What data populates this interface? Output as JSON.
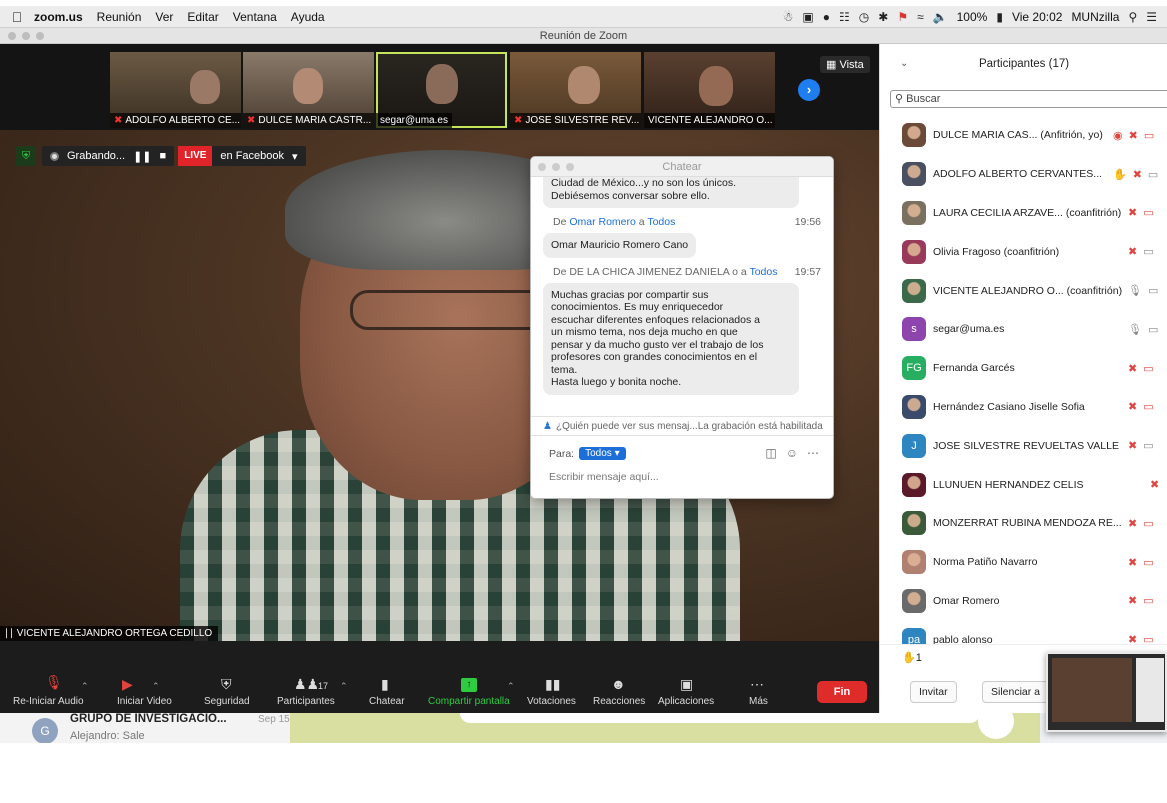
{
  "menubar": {
    "app": "zoom.us",
    "items": [
      "Reunión",
      "Ver",
      "Editar",
      "Ventana",
      "Ayuda"
    ],
    "battery": "100%",
    "clock": "Vie 20:02",
    "user": "MUNzilla"
  },
  "window": {
    "title": "Reunión de Zoom"
  },
  "thumbs": [
    {
      "name": "ADOLFO ALBERTO CE...",
      "muted": true
    },
    {
      "name": "DULCE MARIA CASTR...",
      "muted": true
    },
    {
      "name": "segar@uma.es",
      "muted": false
    },
    {
      "name": "JOSE SILVESTRE REV...",
      "muted": true
    },
    {
      "name": "VICENTE ALEJANDRO O...",
      "muted": false
    }
  ],
  "vista_label": "Vista",
  "recording": {
    "label": "Grabando...",
    "live": "LIVE",
    "live_target": "en Facebook"
  },
  "speaker_name": "VICENTE ALEJANDRO ORTEGA CEDILLO",
  "chat": {
    "title": "Chatear",
    "msg0_line1": "Ciudad de México...y no son los únicos.",
    "msg0_line2": "Debiésemos conversar sobre ello.",
    "msg1_from": "Omar Romero",
    "msg1_to": "Todos",
    "msg1_time": "19:56",
    "msg1_text": "Omar Mauricio Romero Cano",
    "msg2_from": "DE LA CHICA JIMENEZ DANIELA o",
    "msg2_to": "Todos",
    "msg2_time": "19:57",
    "msg2_text": [
      "Muchas gracias por compartir sus",
      "conocimientos. Es muy enriquecedor",
      "escuchar diferentes enfoques relacionados a",
      "un mismo tema, nos deja mucho en que",
      "pensar y da mucho gusto ver el trabajo de los",
      "profesores con grandes conocimientos en el",
      "tema.",
      "Hasta luego y bonita noche."
    ],
    "note": "¿Quién puede ver sus mensaj...La grabación está habilitada",
    "to_label": "Para:",
    "to_value": "Todos",
    "input_placeholder": "Escribir mensaje aquí..."
  },
  "toolbar": {
    "audio": "Re-Iniciar Audio",
    "video": "Iniciar Video",
    "security": "Seguridad",
    "participants": "Participantes",
    "participants_count": "17",
    "chat": "Chatear",
    "share": "Compartir pantalla",
    "polls": "Votaciones",
    "reactions": "Reacciones",
    "apps": "Aplicaciones",
    "more": "Más",
    "end": "Fin"
  },
  "panel": {
    "title": "Participantes (17)",
    "search_placeholder": "Buscar",
    "participants": [
      {
        "name": "DULCE MARIA CAS...",
        "role": "(Anfitrión, yo)",
        "avatar": "photo",
        "color": "#6b4a3a",
        "icons": [
          "rec",
          "mic-muted",
          "cam-off"
        ]
      },
      {
        "name": "ADOLFO ALBERTO CERVANTES...",
        "role": "",
        "avatar": "photo",
        "color": "#4a5060",
        "icons": [
          "hand",
          "mic-muted",
          "cam"
        ]
      },
      {
        "name": "LAURA CECILIA ARZAVE...",
        "role": "(coanfitrión)",
        "avatar": "photo",
        "color": "#7a7060",
        "icons": [
          "mic-muted",
          "cam-off"
        ]
      },
      {
        "name": "Olivia Fragoso",
        "role": "(coanfitrión)",
        "avatar": "photo",
        "color": "#9a3a5a",
        "icons": [
          "mic-muted",
          "cam"
        ]
      },
      {
        "name": "VICENTE ALEJANDRO O...",
        "role": "(coanfitrión)",
        "avatar": "photo",
        "color": "#3a6a4a",
        "icons": [
          "mic",
          "cam"
        ]
      },
      {
        "name": "segar@uma.es",
        "role": "",
        "avatar": "s",
        "color": "#8e44ad",
        "icons": [
          "mic",
          "cam"
        ]
      },
      {
        "name": "Fernanda Garcés",
        "role": "",
        "avatar": "FG",
        "color": "#27ae60",
        "icons": [
          "mic-muted",
          "cam-off"
        ]
      },
      {
        "name": "Hernández Casiano Jiselle Sofia",
        "role": "",
        "avatar": "photo",
        "color": "#3a4a6a",
        "icons": [
          "mic-muted",
          "cam-off"
        ]
      },
      {
        "name": "JOSE SILVESTRE REVUELTAS VALLE",
        "role": "",
        "avatar": "J",
        "color": "#2e86c1",
        "icons": [
          "mic-muted",
          "cam"
        ]
      },
      {
        "name": "LLUNUEN HERNANDEZ CELIS",
        "role": "",
        "avatar": "photo",
        "color": "#5a1a2a",
        "icons": [
          "mic-muted"
        ]
      },
      {
        "name": "MONZERRAT RUBINA MENDOZA RE...",
        "role": "",
        "avatar": "photo",
        "color": "#3a5a3a",
        "icons": [
          "mic-muted",
          "cam-off"
        ]
      },
      {
        "name": "Norma Patiño Navarro",
        "role": "",
        "avatar": "photo",
        "color": "#b08070",
        "icons": [
          "mic-muted",
          "cam-off"
        ]
      },
      {
        "name": "Omar Romero",
        "role": "",
        "avatar": "photo",
        "color": "#6a6a6a",
        "icons": [
          "mic-muted",
          "cam-off"
        ]
      },
      {
        "name": "pablo alonso",
        "role": "",
        "avatar": "pa",
        "color": "#2e86c1",
        "icons": [
          "mic-muted",
          "cam-off"
        ]
      }
    ],
    "raised_hands": "1",
    "invite": "Invitar",
    "mute_all": "Silenciar a"
  },
  "background_app": {
    "avatar": "G",
    "group": "GRUPO DE INVESTIGACIO...",
    "date": "Sep 15",
    "sender": "Alejandro",
    "msg": "Sale"
  }
}
